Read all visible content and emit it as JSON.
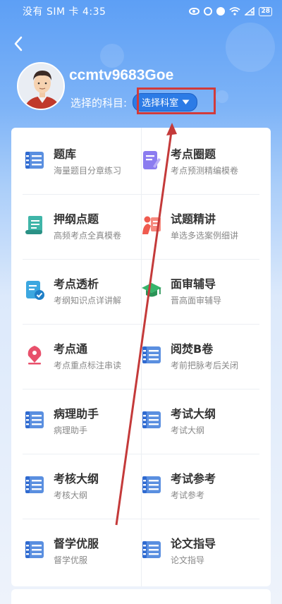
{
  "status_bar": {
    "carrier_time": "没有 SIM 卡 4:35",
    "battery": "28"
  },
  "profile": {
    "username": "ccmtv9683Goe",
    "subject_label": "选择的科目:",
    "dept_button": "选择科室"
  },
  "menu": [
    {
      "title": "题库",
      "sub": "海量题目分章练习",
      "icon": "list-icon"
    },
    {
      "title": "考点圈题",
      "sub": "考点预测精编模卷",
      "icon": "pencil-doc-icon"
    },
    {
      "title": "押纲点题",
      "sub": "高频考点全真模卷",
      "icon": "scroll-icon"
    },
    {
      "title": "试题精讲",
      "sub": "单选多选案例细讲",
      "icon": "teacher-icon"
    },
    {
      "title": "考点透析",
      "sub": "考纲知识点详讲解",
      "icon": "check-doc-icon"
    },
    {
      "title": "面审辅导",
      "sub": "晋高面审辅导",
      "icon": "graduation-cap-icon"
    },
    {
      "title": "考点通",
      "sub": "考点重点标注串读",
      "icon": "pen-nib-icon"
    },
    {
      "title": "阅焚B卷",
      "sub": "考前把脉考后关闭",
      "icon": "list-icon"
    },
    {
      "title": "病理助手",
      "sub": "病理助手",
      "icon": "list-icon"
    },
    {
      "title": "考试大纲",
      "sub": "考试大纲",
      "icon": "list-icon"
    },
    {
      "title": "考核大纲",
      "sub": "考核大纲",
      "icon": "list-icon"
    },
    {
      "title": "考试参考",
      "sub": "考试参考",
      "icon": "list-icon"
    },
    {
      "title": "督学优服",
      "sub": "督学优服",
      "icon": "list-icon"
    },
    {
      "title": "论文指导",
      "sub": "论文指导",
      "icon": "list-icon"
    }
  ],
  "colors": {
    "accent": "#2c7be6",
    "annotation": "#d13b3b",
    "header_bg": "#5d9ff5"
  }
}
